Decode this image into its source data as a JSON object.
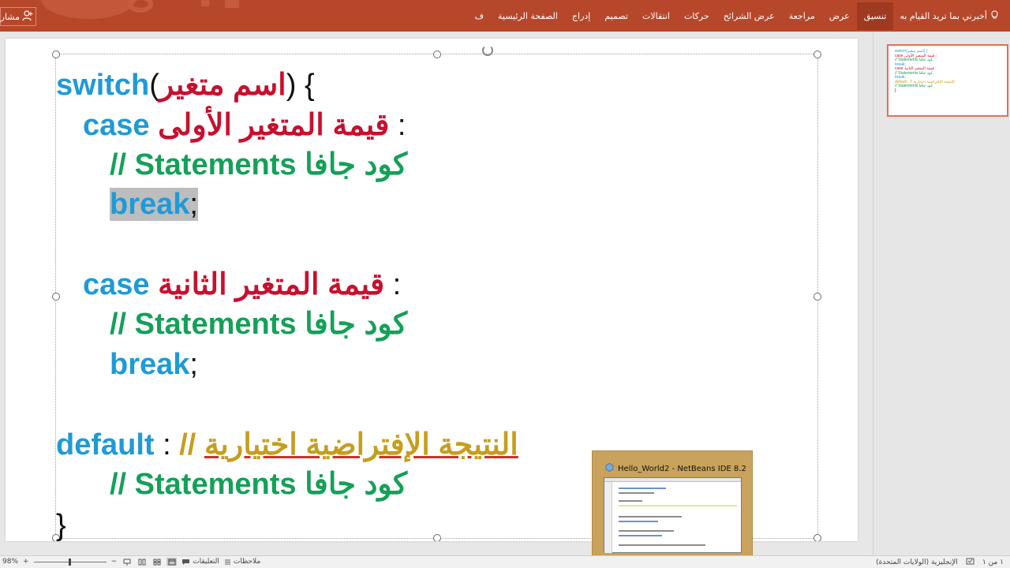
{
  "ribbon": {
    "tabs": [
      {
        "label": "ف",
        "active": false
      },
      {
        "label": "الصفحة الرئيسية",
        "active": false
      },
      {
        "label": "إدراج",
        "active": false
      },
      {
        "label": "تصميم",
        "active": false
      },
      {
        "label": "انتقالات",
        "active": false
      },
      {
        "label": "حركات",
        "active": false
      },
      {
        "label": "عرض الشرائح",
        "active": false
      },
      {
        "label": "مراجعة",
        "active": false
      },
      {
        "label": "عرض",
        "active": false
      },
      {
        "label": "تنسيق",
        "active": true
      }
    ],
    "tell_me": "أخبرني بما تريد القيام به",
    "share": "مشارك"
  },
  "slide": {
    "lines": [
      {
        "parts": [
          {
            "t": "switch",
            "c": "kw"
          },
          {
            "t": "(",
            "c": "blk"
          },
          {
            "t": "اسم متغير",
            "c": "ar-red"
          },
          {
            "t": ") {",
            "c": "blk"
          }
        ]
      },
      {
        "parts": [
          {
            "t": "case ",
            "c": "kw"
          },
          {
            "t": "قيمة المتغير الأولى",
            "c": "ar-red"
          },
          {
            "t": " :",
            "c": "blk"
          }
        ]
      },
      {
        "parts": [
          {
            "t": "// Statements ",
            "c": "ar-green"
          },
          {
            "t": "كود جافا",
            "c": "ar-green"
          }
        ]
      },
      {
        "parts": [
          {
            "t": "break",
            "c": "kw hl"
          },
          {
            "t": ";",
            "c": "blk hl"
          }
        ]
      },
      {
        "parts": [
          {
            "t": "case ",
            "c": "kw"
          },
          {
            "t": "قيمة المتغير الثانية",
            "c": "ar-red"
          },
          {
            "t": " :",
            "c": "blk"
          }
        ]
      },
      {
        "parts": [
          {
            "t": "// Statements ",
            "c": "ar-green"
          },
          {
            "t": "كود جافا",
            "c": "ar-green"
          }
        ]
      },
      {
        "parts": [
          {
            "t": "break",
            "c": "kw"
          },
          {
            "t": ";",
            "c": "blk"
          }
        ]
      },
      {
        "parts": [
          {
            "t": "default",
            "c": "kw"
          },
          {
            "t": " : ",
            "c": "blk"
          },
          {
            "t": "// ",
            "c": "ar-gold"
          },
          {
            "t": "النتيجة الإفتراضية اختيارية",
            "c": "ar-gold red-underline"
          }
        ]
      },
      {
        "parts": [
          {
            "t": "// Statements ",
            "c": "ar-green"
          },
          {
            "t": "كود جافا",
            "c": "ar-green"
          }
        ]
      },
      {
        "parts": [
          {
            "t": "}",
            "c": "blk"
          }
        ]
      }
    ]
  },
  "thumbnail": {
    "lines": [
      {
        "t": "switch(اسم متغير) {",
        "c": "#1f9ad6"
      },
      {
        "t": "  case قيمة المتغير الأولى :",
        "c": "#c8102e"
      },
      {
        "t": "    // Statements كود جافا",
        "c": "#15a058"
      },
      {
        "t": "    break;",
        "c": "#1f9ad6"
      },
      {
        "t": " ",
        "c": "#111"
      },
      {
        "t": "  case قيمة المتغير الثانية :",
        "c": "#c8102e"
      },
      {
        "t": "    // Statements كود جافا",
        "c": "#15a058"
      },
      {
        "t": "    break;",
        "c": "#1f9ad6"
      },
      {
        "t": " ",
        "c": "#111"
      },
      {
        "t": "default : // النتيجة الإفتراضية اختيارية",
        "c": "#c69e1d"
      },
      {
        "t": "    // Statements كود جافا",
        "c": "#15a058"
      },
      {
        "t": "}",
        "c": "#111"
      }
    ]
  },
  "taskbar_preview": {
    "title": "Hello_World2 - NetBeans IDE 8.2"
  },
  "status_bar": {
    "zoom": "98%",
    "notes": "ملاحظات",
    "comments": "التعليقات",
    "language": "الإنجليزية (الولايات المتحدة)",
    "slide_counter": "١ من ١"
  },
  "colors": {
    "ribbon": "#b7472a",
    "keyword": "#1f9ad6",
    "arabic_red": "#c8102e",
    "arabic_green": "#15a058",
    "arabic_gold": "#c69e1d"
  }
}
